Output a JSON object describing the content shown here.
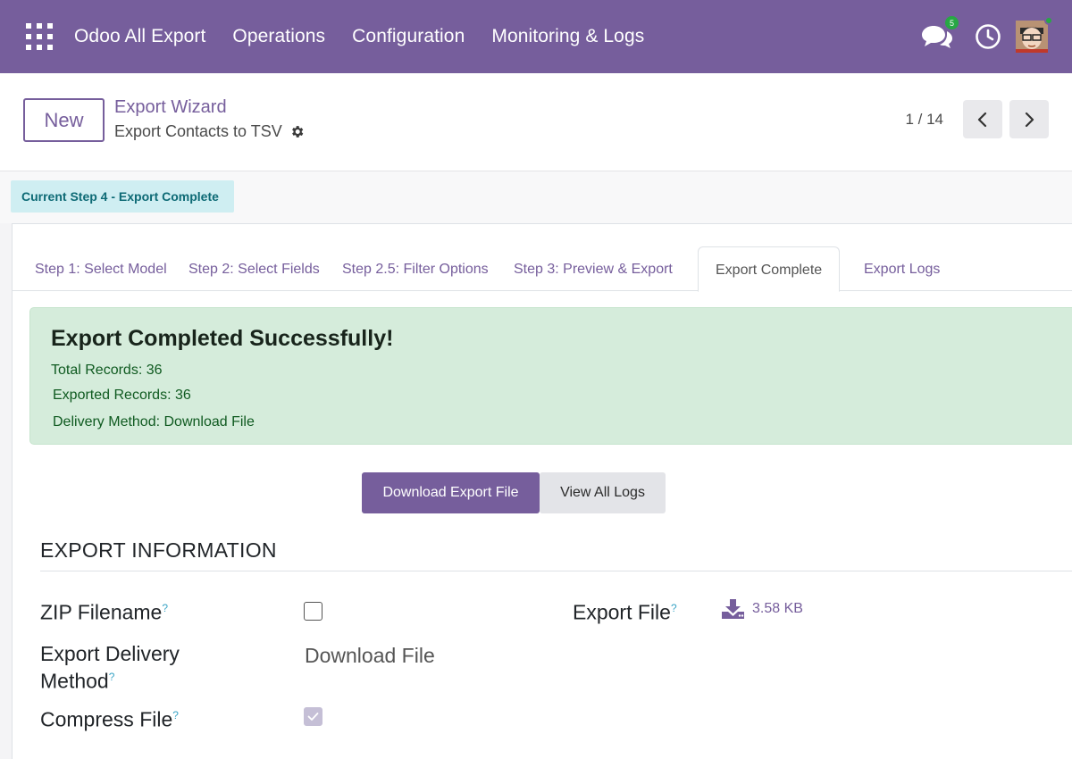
{
  "nav": {
    "app_name": "Odoo All Export",
    "menus": [
      "Operations",
      "Configuration",
      "Monitoring & Logs"
    ],
    "messages_badge": "5"
  },
  "control": {
    "new_label": "New",
    "breadcrumb": "Export Wizard",
    "record_title": "Export Contacts to TSV",
    "pager": "1 / 14"
  },
  "status": {
    "current_step": "Current Step 4 - Export Complete"
  },
  "tabs": [
    "Step 1: Select Model",
    "Step 2: Select Fields",
    "Step 2.5: Filter Options",
    "Step 3: Preview & Export",
    "Export Complete",
    "Export Logs"
  ],
  "alert": {
    "title": "Export Completed Successfully!",
    "total_records": "Total Records: 36",
    "exported_records": "Exported Records: 36",
    "delivery_method": "Delivery Method: Download File"
  },
  "actions": {
    "download": "Download Export File",
    "view_logs": "View All Logs"
  },
  "section": {
    "title": "EXPORT INFORMATION"
  },
  "fields": {
    "zip_filename_label": "ZIP Filename",
    "delivery_label_1": "Export Delivery",
    "delivery_label_2": "Method",
    "delivery_value": "Download File",
    "compress_label": "Compress File",
    "compress_checked": true,
    "zip_checked": false,
    "export_file_label": "Export File",
    "export_file_size": "3.58 KB",
    "help_mark": "?"
  },
  "colors": {
    "brand": "#765e9c",
    "success_bg": "#d5ecdb",
    "info_bg": "#cfeef2"
  }
}
